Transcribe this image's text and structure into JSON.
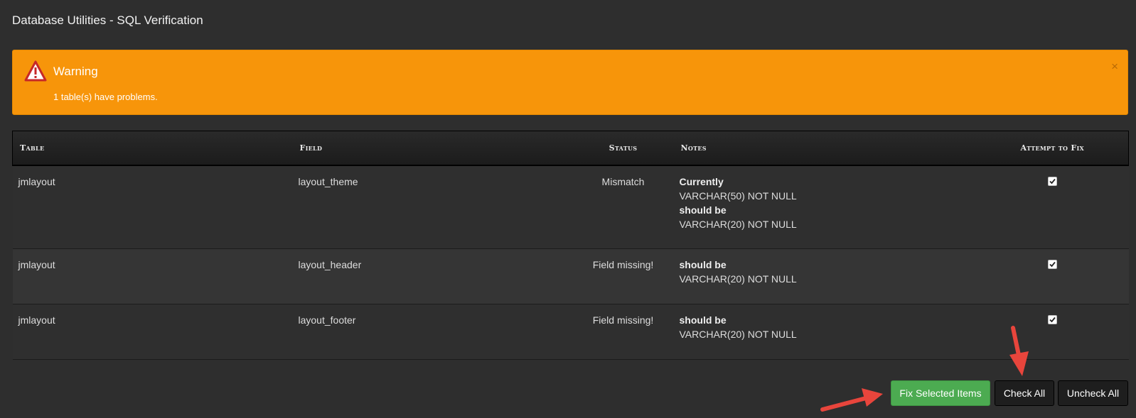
{
  "page": {
    "title": "Database Utilities - SQL Verification"
  },
  "alert": {
    "title": "Warning",
    "message": "1 table(s) have problems.",
    "close_glyph": "×",
    "icon": "warning-triangle-icon",
    "color": "#f7950a"
  },
  "table": {
    "headers": {
      "table": "Table",
      "field": "Field",
      "status": "Status",
      "notes": "Notes",
      "fix": "Attempt to Fix"
    },
    "rows": [
      {
        "table": "jmlayout",
        "field": "layout_theme",
        "status": "Mismatch",
        "currently_label": "Currently",
        "currently_value": "VARCHAR(50) NOT NULL",
        "should_be_label": "should be",
        "should_be_value": "VARCHAR(20) NOT NULL",
        "checked": true
      },
      {
        "table": "jmlayout",
        "field": "layout_header",
        "status": "Field missing!",
        "should_be_label": "should be",
        "should_be_value": "VARCHAR(20) NOT NULL",
        "checked": true
      },
      {
        "table": "jmlayout",
        "field": "layout_footer",
        "status": "Field missing!",
        "should_be_label": "should be",
        "should_be_value": "VARCHAR(20) NOT NULL",
        "checked": true
      }
    ]
  },
  "actions": {
    "fix_selected": "Fix Selected Items",
    "check_all": "Check All",
    "uncheck_all": "Uncheck All"
  },
  "colors": {
    "background": "#2e2e2e",
    "success_button": "#4cab51",
    "annotation_arrow": "#e8453c"
  }
}
